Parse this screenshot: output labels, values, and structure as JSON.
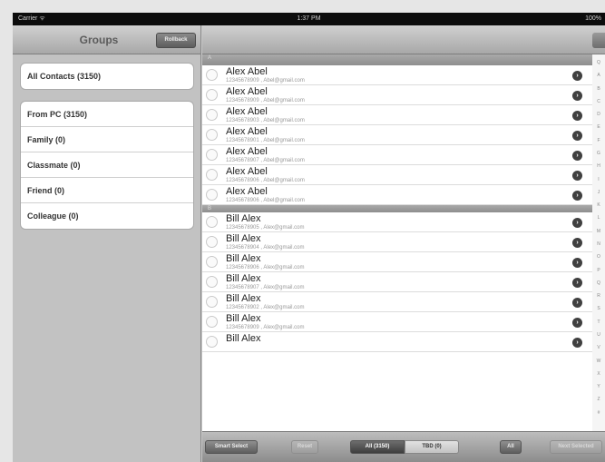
{
  "status_bar": {
    "carrier": "Carrier ᯤ",
    "time": "1:37 PM",
    "battery": "100%"
  },
  "groups_pane": {
    "title": "Groups",
    "rollback_label": "Rollback",
    "all_contacts": "All Contacts (3150)",
    "groups": [
      "From PC (3150)",
      "Family (0)",
      "Classmate (0)",
      "Friend (0)",
      "Colleague (0)"
    ]
  },
  "sections": [
    {
      "letter": "A",
      "ghost_name": "Alex Abel",
      "rows": [
        {
          "name": "Alex Abel",
          "detail": "12345678909 , Abel@gmail.com"
        },
        {
          "name": "Alex Abel",
          "detail": "12345678909 , Abel@gmail.com"
        },
        {
          "name": "Alex Abel",
          "detail": "12345678903 , Abel@gmail.com"
        },
        {
          "name": "Alex Abel",
          "detail": "12345678901 , Abel@gmail.com"
        },
        {
          "name": "Alex Abel",
          "detail": "12345678907 , Abel@gmail.com"
        },
        {
          "name": "Alex Abel",
          "detail": "12345678906 , Abel@gmail.com"
        },
        {
          "name": "Alex Abel",
          "detail": "12345678906 , Abel@gmail.com"
        }
      ]
    },
    {
      "letter": "B",
      "rows": [
        {
          "name": "Bill Alex",
          "detail": "12345678905 , Alex@gmail.com"
        },
        {
          "name": "Bill Alex",
          "detail": "12345678904 , Alex@gmail.com"
        },
        {
          "name": "Bill Alex",
          "detail": "12345678906 , Alex@gmail.com"
        },
        {
          "name": "Bill Alex",
          "detail": "12345678907 , Alex@gmail.com"
        },
        {
          "name": "Bill Alex",
          "detail": "12345678902 , Alex@gmail.com"
        },
        {
          "name": "Bill Alex",
          "detail": "12345678909 , Alex@gmail.com"
        },
        {
          "name": "Bill Alex",
          "detail": ""
        }
      ]
    }
  ],
  "index_letters": [
    "Q",
    "A",
    "B",
    "C",
    "D",
    "E",
    "F",
    "G",
    "H",
    "I",
    "J",
    "K",
    "L",
    "M",
    "N",
    "O",
    "P",
    "Q",
    "R",
    "S",
    "T",
    "U",
    "V",
    "W",
    "X",
    "Y",
    "Z",
    "#"
  ],
  "toolbar": {
    "smart_select": "Smart Select",
    "reset": "Reset",
    "segment_all": "All (3150)",
    "segment_tbd": "TBD (0)",
    "all": "All",
    "next": "Next Selected"
  }
}
